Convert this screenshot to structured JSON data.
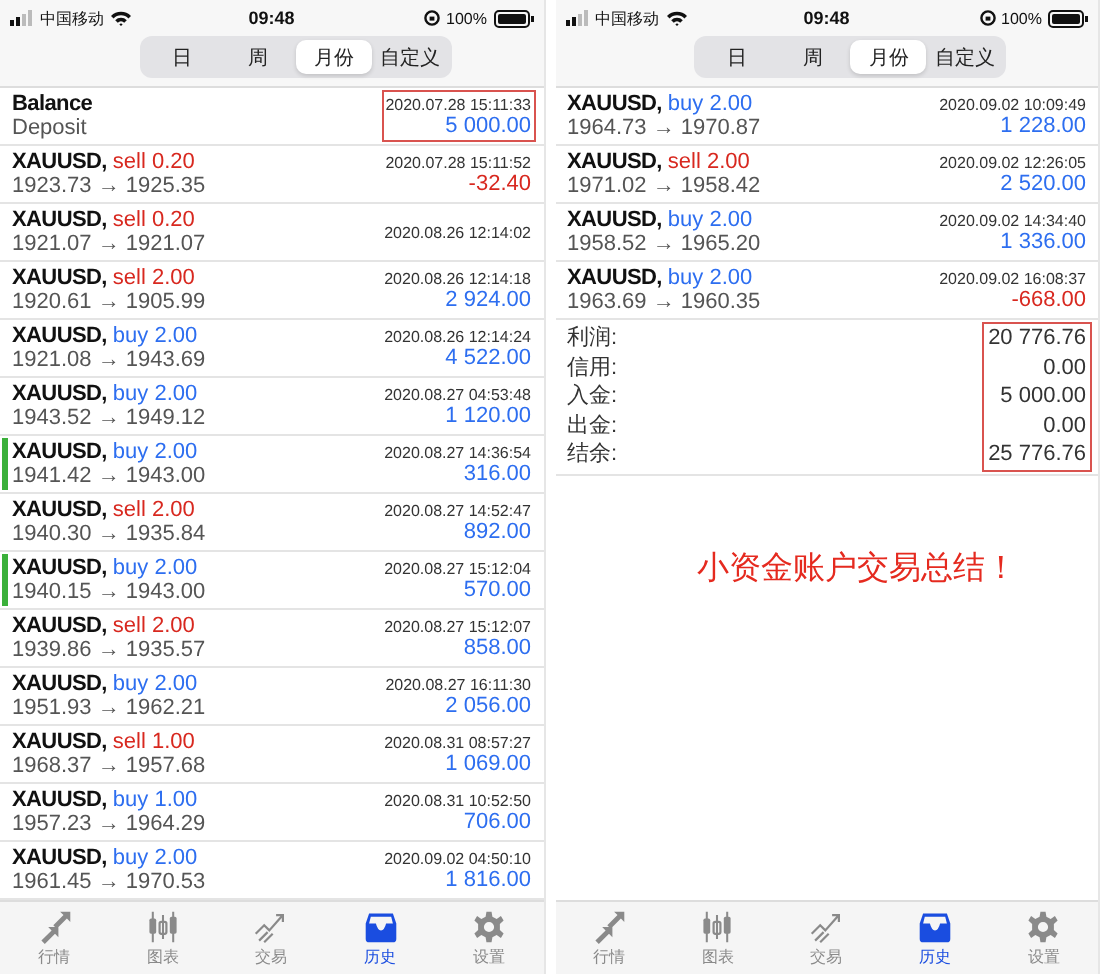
{
  "phones": [
    {
      "status_bar": {
        "carrier": "中国移动",
        "time": "09:48",
        "battery": "100%"
      },
      "segments": [
        {
          "label": "日",
          "selected": false
        },
        {
          "label": "周",
          "selected": false
        },
        {
          "label": "月份",
          "selected": true
        },
        {
          "label": "自定义",
          "selected": false
        }
      ],
      "rows": [
        {
          "kind": "balance",
          "title": "Balance",
          "subtitle": "Deposit",
          "time": "2020.07.28 15:11:33",
          "amount": {
            "text": "5 000.00",
            "color": "#2d6ef0"
          },
          "highlighted": true,
          "marked": false
        },
        {
          "kind": "trade",
          "title": "XAUUSD,",
          "order": {
            "text": "sell 0.20",
            "color": "#d8281f"
          },
          "prices": "1923.73 → 1925.35",
          "time": "2020.07.28 15:11:52",
          "amount": {
            "text": "-32.40",
            "color": "#d8281f"
          },
          "marked": false
        },
        {
          "kind": "trade",
          "title": "XAUUSD,",
          "order": {
            "text": "sell 0.20",
            "color": "#d8281f"
          },
          "prices": "1921.07 → 1921.07",
          "time": "2020.08.26 12:14:02",
          "marked": false
        },
        {
          "kind": "trade",
          "title": "XAUUSD,",
          "order": {
            "text": "sell 2.00",
            "color": "#d8281f"
          },
          "prices": "1920.61 → 1905.99",
          "time": "2020.08.26 12:14:18",
          "amount": {
            "text": "2 924.00",
            "color": "#2d6ef0"
          },
          "marked": false
        },
        {
          "kind": "trade",
          "title": "XAUUSD,",
          "order": {
            "text": "buy 2.00",
            "color": "#2d6ef0"
          },
          "prices": "1921.08 → 1943.69",
          "time": "2020.08.26 12:14:24",
          "amount": {
            "text": "4 522.00",
            "color": "#2d6ef0"
          },
          "marked": false
        },
        {
          "kind": "trade",
          "title": "XAUUSD,",
          "order": {
            "text": "buy 2.00",
            "color": "#2d6ef0"
          },
          "prices": "1943.52 → 1949.12",
          "time": "2020.08.27 04:53:48",
          "amount": {
            "text": "1 120.00",
            "color": "#2d6ef0"
          },
          "marked": false
        },
        {
          "kind": "trade",
          "title": "XAUUSD,",
          "order": {
            "text": "buy 2.00",
            "color": "#2d6ef0"
          },
          "prices": "1941.42 → 1943.00",
          "time": "2020.08.27 14:36:54",
          "amount": {
            "text": "316.00",
            "color": "#2d6ef0"
          },
          "marked": true
        },
        {
          "kind": "trade",
          "title": "XAUUSD,",
          "order": {
            "text": "sell 2.00",
            "color": "#d8281f"
          },
          "prices": "1940.30 → 1935.84",
          "time": "2020.08.27 14:52:47",
          "amount": {
            "text": "892.00",
            "color": "#2d6ef0"
          },
          "marked": false
        },
        {
          "kind": "trade",
          "title": "XAUUSD,",
          "order": {
            "text": "buy 2.00",
            "color": "#2d6ef0"
          },
          "prices": "1940.15 → 1943.00",
          "time": "2020.08.27 15:12:04",
          "amount": {
            "text": "570.00",
            "color": "#2d6ef0"
          },
          "marked": true
        },
        {
          "kind": "trade",
          "title": "XAUUSD,",
          "order": {
            "text": "sell 2.00",
            "color": "#d8281f"
          },
          "prices": "1939.86 → 1935.57",
          "time": "2020.08.27 15:12:07",
          "amount": {
            "text": "858.00",
            "color": "#2d6ef0"
          },
          "marked": false
        },
        {
          "kind": "trade",
          "title": "XAUUSD,",
          "order": {
            "text": "buy 2.00",
            "color": "#2d6ef0"
          },
          "prices": "1951.93 → 1962.21",
          "time": "2020.08.27 16:11:30",
          "amount": {
            "text": "2 056.00",
            "color": "#2d6ef0"
          },
          "marked": false
        },
        {
          "kind": "trade",
          "title": "XAUUSD,",
          "order": {
            "text": "sell 1.00",
            "color": "#d8281f"
          },
          "prices": "1968.37 → 1957.68",
          "time": "2020.08.31 08:57:27",
          "amount": {
            "text": "1 069.00",
            "color": "#2d6ef0"
          },
          "marked": false
        },
        {
          "kind": "trade",
          "title": "XAUUSD,",
          "order": {
            "text": "buy 1.00",
            "color": "#2d6ef0"
          },
          "prices": "1957.23 → 1964.29",
          "time": "2020.08.31 10:52:50",
          "amount": {
            "text": "706.00",
            "color": "#2d6ef0"
          },
          "marked": false
        },
        {
          "kind": "trade",
          "title": "XAUUSD,",
          "order": {
            "text": "buy 2.00",
            "color": "#2d6ef0"
          },
          "prices": "1961.45 → 1970.53",
          "time": "2020.09.02 04:50:10",
          "amount": {
            "text": "1 816.00",
            "color": "#2d6ef0"
          },
          "marked": false
        }
      ],
      "tabbar": [
        {
          "kind": "quotes",
          "label": "行情",
          "selected": false
        },
        {
          "kind": "chart",
          "label": "图表",
          "selected": false
        },
        {
          "kind": "trade",
          "label": "交易",
          "selected": false
        },
        {
          "kind": "history",
          "label": "历史",
          "selected": true
        },
        {
          "kind": "settings",
          "label": "设置",
          "selected": false
        }
      ]
    },
    {
      "status_bar": {
        "carrier": "中国移动",
        "time": "09:48",
        "battery": "100%"
      },
      "segments": [
        {
          "label": "日",
          "selected": false
        },
        {
          "label": "周",
          "selected": false
        },
        {
          "label": "月份",
          "selected": true
        },
        {
          "label": "自定义",
          "selected": false
        }
      ],
      "rows": [
        {
          "kind": "trade",
          "title": "XAUUSD,",
          "order": {
            "text": "buy 2.00",
            "color": "#2d6ef0"
          },
          "prices": "1964.73 → 1970.87",
          "time": "2020.09.02 10:09:49",
          "amount": {
            "text": "1 228.00",
            "color": "#2d6ef0"
          },
          "marked": false
        },
        {
          "kind": "trade",
          "title": "XAUUSD,",
          "order": {
            "text": "sell 2.00",
            "color": "#d8281f"
          },
          "prices": "1971.02 → 1958.42",
          "time": "2020.09.02 12:26:05",
          "amount": {
            "text": "2 520.00",
            "color": "#2d6ef0"
          },
          "marked": false
        },
        {
          "kind": "trade",
          "title": "XAUUSD,",
          "order": {
            "text": "buy 2.00",
            "color": "#2d6ef0"
          },
          "prices": "1958.52 → 1965.20",
          "time": "2020.09.02 14:34:40",
          "amount": {
            "text": "1 336.00",
            "color": "#2d6ef0"
          },
          "marked": false
        },
        {
          "kind": "trade",
          "title": "XAUUSD,",
          "order": {
            "text": "buy 2.00",
            "color": "#2d6ef0"
          },
          "prices": "1963.69 → 1960.35",
          "time": "2020.09.02 16:08:37",
          "amount": {
            "text": "-668.00",
            "color": "#d8281f"
          },
          "marked": false
        }
      ],
      "summary": {
        "highlighted": true,
        "items": [
          {
            "label": "利润:",
            "value": "20 776.76"
          },
          {
            "label": "信用:",
            "value": "0.00"
          },
          {
            "label": "入金:",
            "value": "5 000.00"
          },
          {
            "label": "出金:",
            "value": "0.00"
          },
          {
            "label": "结余:",
            "value": "25 776.76"
          }
        ]
      },
      "caption": "小资金账户交易总结！",
      "tabbar": [
        {
          "kind": "quotes",
          "label": "行情",
          "selected": false
        },
        {
          "kind": "chart",
          "label": "图表",
          "selected": false
        },
        {
          "kind": "trade",
          "label": "交易",
          "selected": false
        },
        {
          "kind": "history",
          "label": "历史",
          "selected": true
        },
        {
          "kind": "settings",
          "label": "设置",
          "selected": false
        }
      ]
    }
  ]
}
